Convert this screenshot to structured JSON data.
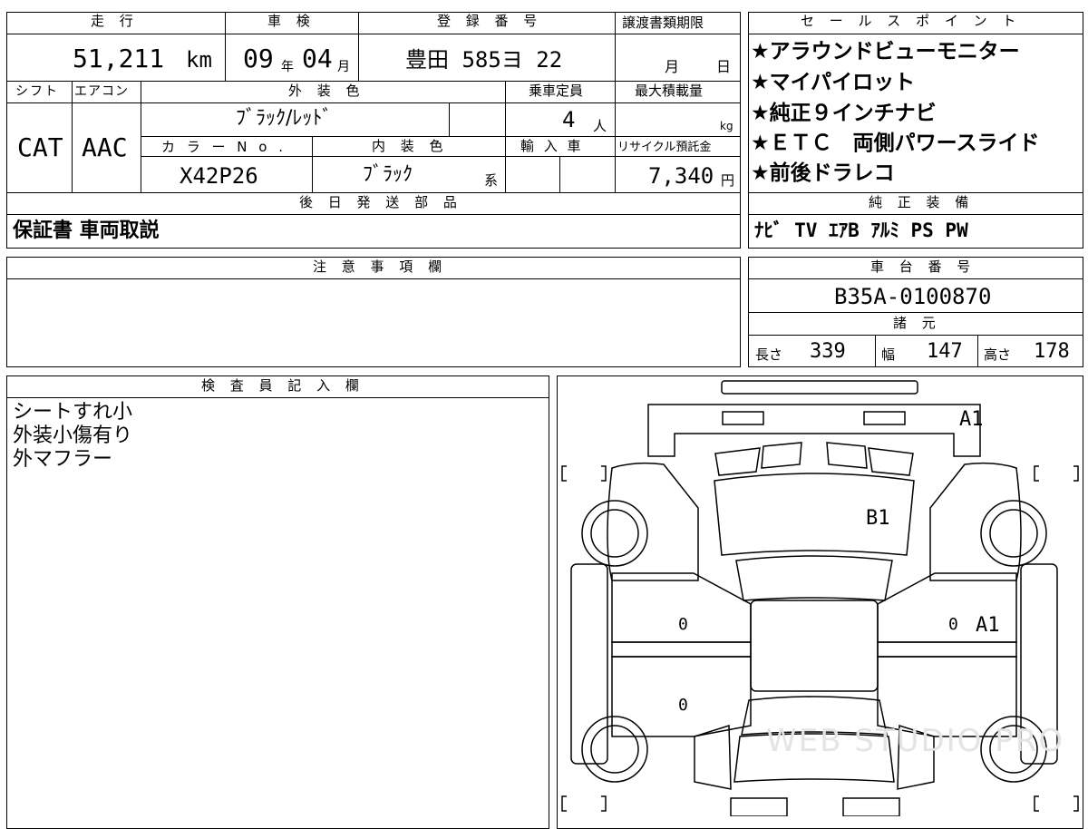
{
  "headers": {
    "mileage": "走 行",
    "inspection": "車 検",
    "registration": "登 録 番 号",
    "transfer_deadline": "譲渡書類期限",
    "sales_points": "セ ー ル ス ポ イ ン ト",
    "shift": "シフト",
    "aircon": "エアコン",
    "exterior_color": "外 装 色",
    "capacity": "乗車定員",
    "max_load": "最大積載量",
    "color_no": "カ ラ ー  N o .",
    "interior_color": "内 装 色",
    "import": "輸 入 車",
    "recycle": "リサイクル預託金",
    "later_parts": "後 日 発 送 部 品",
    "genuine_equipment": "純 正 装 備",
    "notes": "注 意 事 項 欄",
    "chassis": "車 台 番 号",
    "specs": "諸 元",
    "inspector": "検 査 員 記 入 欄"
  },
  "values": {
    "mileage": "51,211",
    "mileage_unit": "km",
    "inspection_year": "09",
    "inspection_year_unit": "年",
    "inspection_month": "04",
    "inspection_month_unit": "月",
    "registration": "豊田 585ヨ  22",
    "deadline_month_unit": "月",
    "deadline_day_unit": "日",
    "shift": "CAT",
    "aircon": "AAC",
    "exterior_color": "ﾌﾞﾗｯｸ/ﾚｯﾄﾞ",
    "capacity": "4",
    "capacity_unit": "人",
    "max_load_unit": "kg",
    "color_no": "X42P26",
    "interior_color": "ﾌﾞﾗｯｸ",
    "interior_suffix": "系",
    "recycle": "7,340",
    "recycle_unit": "円",
    "later_parts": "保証書 車両取説",
    "genuine_equipment": "ﾅﾋﾞ TV ｴｱB ｱﾙﾐ PS PW",
    "chassis": "B35A-0100870",
    "length_label": "長さ",
    "length": "339",
    "width_label": "幅",
    "width": "147",
    "height_label": "高さ",
    "height": "178"
  },
  "sales_points": [
    "★アラウンドビューモニター",
    "★マイパイロット",
    "★純正９インチナビ",
    "★ＥＴＣ　両側パワースライド",
    "★前後ドラレコ"
  ],
  "inspector_notes": [
    "シートすれ小",
    "外装小傷有り",
    "外マフラー"
  ],
  "diagram": {
    "marks": {
      "front_bumper": "A1",
      "windshield": "B1",
      "right_rear_door": "A1",
      "left_front_door_zero": "0",
      "left_rear_door_zero": "0",
      "right_front_door_zero": "0"
    },
    "watermark": "WEB STUDIO PRO"
  }
}
